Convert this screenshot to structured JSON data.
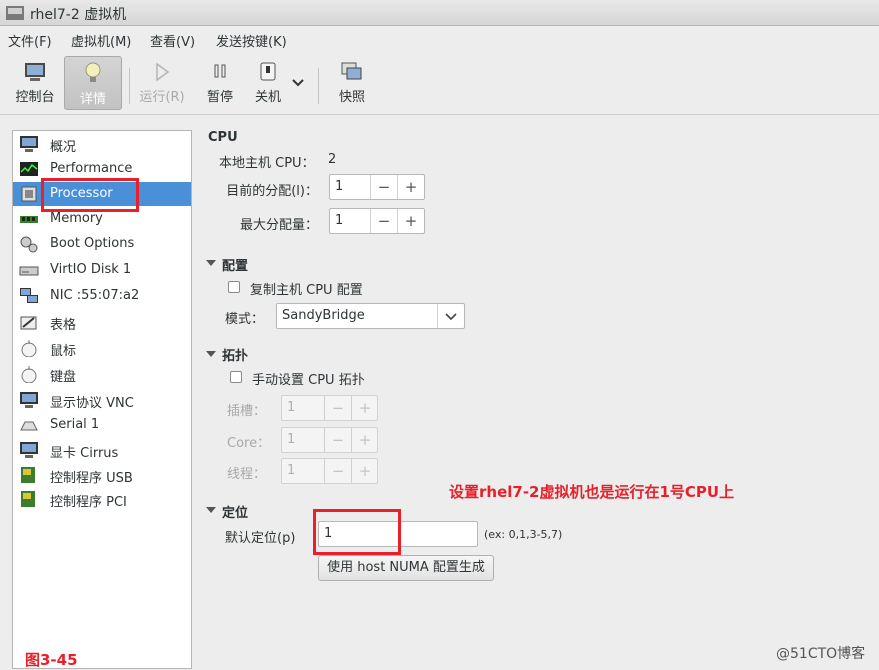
{
  "window": {
    "title": "rhel7-2 虚拟机"
  },
  "menubar": [
    "文件(F)",
    "虚拟机(M)",
    "查看(V)",
    "发送按键(K)"
  ],
  "toolbar": {
    "console": "控制台",
    "details": "详情",
    "run": "运行(R)",
    "pause": "暂停",
    "shutdown": "关机",
    "snapshot": "快照"
  },
  "sidebar": [
    {
      "label": "概况",
      "icon": "monitor-icon"
    },
    {
      "label": "Performance",
      "icon": "performance-graph-icon"
    },
    {
      "label": "Processor",
      "icon": "cpu-chip-icon"
    },
    {
      "label": "Memory",
      "icon": "memory-module-icon"
    },
    {
      "label": "Boot Options",
      "icon": "gears-icon"
    },
    {
      "label": "VirtIO Disk 1",
      "icon": "disk-drive-icon"
    },
    {
      "label": "NIC :55:07:a2",
      "icon": "network-icon"
    },
    {
      "label": "表格",
      "icon": "tablet-icon"
    },
    {
      "label": "鼠标",
      "icon": "mouse-icon"
    },
    {
      "label": "键盘",
      "icon": "keyboard-icon"
    },
    {
      "label": "显示协议 VNC",
      "icon": "display-icon"
    },
    {
      "label": "Serial 1",
      "icon": "serial-port-icon"
    },
    {
      "label": "显卡 Cirrus",
      "icon": "video-card-icon"
    },
    {
      "label": "控制程序 USB",
      "icon": "usb-controller-icon"
    },
    {
      "label": "控制程序 PCI",
      "icon": "pci-controller-icon"
    }
  ],
  "cpu": {
    "heading": "CPU",
    "host_label": "本地主机 CPU：",
    "host_value": "2",
    "current_label": "目前的分配(l)：",
    "current_value": "1",
    "max_label": "最大分配量：",
    "max_value": "1"
  },
  "config": {
    "heading": "配置",
    "copy_host_label": "复制主机 CPU 配置",
    "mode_label": "模式：",
    "mode_value": "SandyBridge"
  },
  "topology": {
    "heading": "拓扑",
    "manual_label": "手动设置 CPU 拓扑",
    "sockets_label": "插槽：",
    "sockets_value": "1",
    "cores_label": "Core：",
    "cores_value": "1",
    "threads_label": "线程：",
    "threads_value": "1"
  },
  "pinning": {
    "heading": "定位",
    "default_label": "默认定位(p)",
    "default_value": "1",
    "example": "(ex: 0,1,3-5,7)",
    "numa_button": "使用 host NUMA 配置生成"
  },
  "annotation": "设置rhel7-2虚拟机也是运行在1号CPU上",
  "figure_label": "图3-45",
  "watermark": "@51CTO博客",
  "colors": {
    "accent": "#4a90d9",
    "annotation": "#e8202a"
  }
}
